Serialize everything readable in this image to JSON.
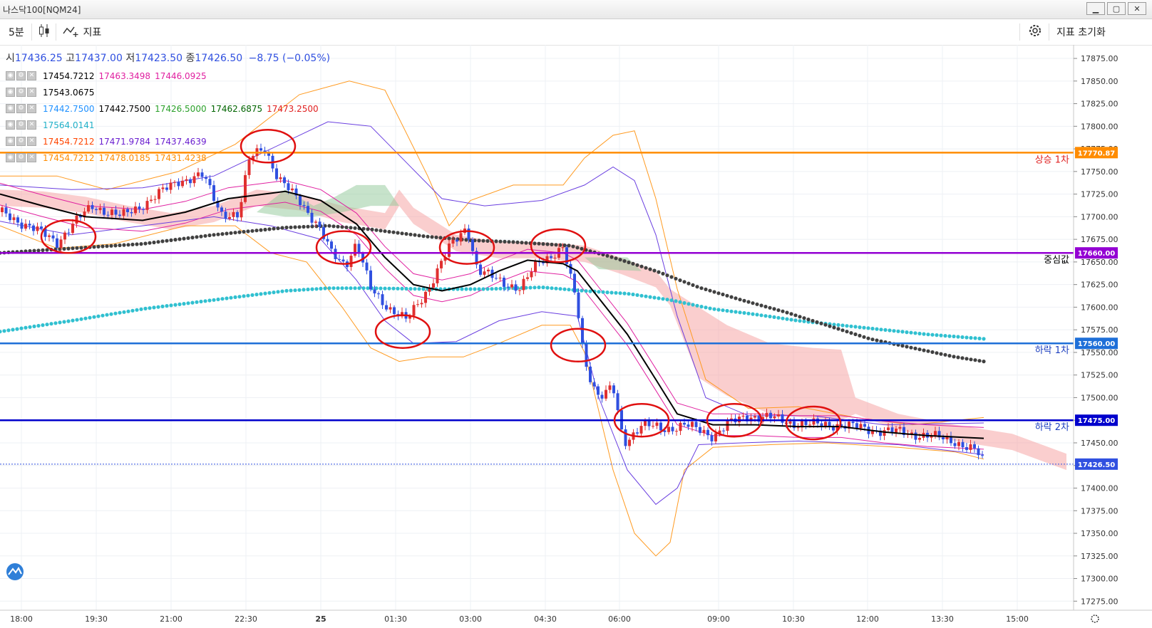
{
  "window": {
    "title": "나스닥100[NQM24]",
    "buttons": [
      "▁",
      "▢",
      "✕"
    ]
  },
  "toolbar": {
    "interval": "5분",
    "indicator_label": "지표",
    "reset_label": "지표 초기화"
  },
  "ohlc": {
    "open_label": "시",
    "open": "17436.25",
    "high_label": "고",
    "high": "17437.00",
    "low_label": "저",
    "low": "17423.50",
    "close_label": "종",
    "close": "17426.50",
    "change": "−8.75 (−0.05%)"
  },
  "indicators": [
    {
      "values": [
        {
          "v": "17454.7212",
          "c": "#000000"
        },
        {
          "v": "17463.3498",
          "c": "#e020a0"
        },
        {
          "v": "17446.0925",
          "c": "#e020a0"
        }
      ]
    },
    {
      "values": [
        {
          "v": "17543.0675",
          "c": "#000000"
        }
      ]
    },
    {
      "values": [
        {
          "v": "17442.7500",
          "c": "#1e90ff"
        },
        {
          "v": "17442.7500",
          "c": "#000000"
        },
        {
          "v": "17426.5000",
          "c": "#2aa02a"
        },
        {
          "v": "17462.6875",
          "c": "#006400"
        },
        {
          "v": "17473.2500",
          "c": "#e02020"
        }
      ]
    },
    {
      "values": [
        {
          "v": "17564.0141",
          "c": "#20b0c8"
        }
      ]
    },
    {
      "values": [
        {
          "v": "17454.7212",
          "c": "#ff4500"
        },
        {
          "v": "17471.9784",
          "c": "#6a1fd0"
        },
        {
          "v": "17437.4639",
          "c": "#6a1fd0"
        }
      ]
    },
    {
      "values": [
        {
          "v": "17454.7212",
          "c": "#ff8c00"
        },
        {
          "v": "17478.0185",
          "c": "#ff8c00"
        },
        {
          "v": "17431.4238",
          "c": "#ff8c00"
        }
      ]
    }
  ],
  "colors": {
    "up": "#e03030",
    "down": "#3050e0",
    "grid": "#eef0f4",
    "ma": "#000000",
    "dots_dark": "#404040",
    "dots_cyan": "#30c0d0"
  },
  "chart_data": {
    "type": "candlestick",
    "y_axis_ticks": [
      17875,
      17850,
      17825,
      17800,
      17775,
      17750,
      17725,
      17700,
      17675,
      17650,
      17625,
      17600,
      17575,
      17550,
      17525,
      17500,
      17475,
      17450,
      17425,
      17400,
      17375,
      17350,
      17325,
      17300,
      17275
    ],
    "y_tick_labels": [
      "17875.00",
      "17850.00",
      "17825.00",
      "17800.00",
      "17775.00",
      "17750.00",
      "17725.00",
      "17700.00",
      "17675.00",
      "17650.00",
      "17625.00",
      "17600.00",
      "17575.00",
      "17550.00",
      "17525.00",
      "17500.00",
      "17475.00",
      "17450.00",
      "17425.00",
      "17400.00",
      "17375.00",
      "17350.00",
      "17325.00",
      "17300.00",
      "17275.00"
    ],
    "ylim": [
      17265,
      17890
    ],
    "x_tick_labels": [
      "18:00",
      "19:30",
      "21:00",
      "22:30",
      "25",
      "01:30",
      "03:00",
      "04:30",
      "06:00",
      "09:00",
      "10:30",
      "12:00",
      "13:30",
      "15:00"
    ],
    "last_price": 17426.5,
    "last_price_label": "17426.50",
    "horizontal_levels": [
      {
        "value": 17770.87,
        "value_label": "17770.87",
        "label": "상승 1차",
        "color": "#ff8c00"
      },
      {
        "value": 17660.0,
        "value_label": "17660.00",
        "label": "중심값",
        "color": "#9400d3"
      },
      {
        "value": 17560.0,
        "value_label": "17560.00",
        "label": "하락 1차",
        "color": "#1e6fd8"
      },
      {
        "value": 17475.0,
        "value_label": "17475.00",
        "label": "하락 2차",
        "color": "#0000cc"
      }
    ],
    "price_path": [
      [
        0,
        17705
      ],
      [
        40,
        17690
      ],
      [
        80,
        17672
      ],
      [
        100,
        17690
      ],
      [
        130,
        17712
      ],
      [
        170,
        17700
      ],
      [
        210,
        17718
      ],
      [
        250,
        17740
      ],
      [
        285,
        17745
      ],
      [
        310,
        17705
      ],
      [
        335,
        17700
      ],
      [
        350,
        17765
      ],
      [
        370,
        17780
      ],
      [
        390,
        17740
      ],
      [
        420,
        17720
      ],
      [
        445,
        17690
      ],
      [
        465,
        17660
      ],
      [
        485,
        17648
      ],
      [
        500,
        17670
      ],
      [
        520,
        17620
      ],
      [
        545,
        17600
      ],
      [
        570,
        17585
      ],
      [
        600,
        17620
      ],
      [
        630,
        17665
      ],
      [
        655,
        17690
      ],
      [
        670,
        17640
      ],
      [
        700,
        17630
      ],
      [
        730,
        17620
      ],
      [
        755,
        17650
      ],
      [
        790,
        17665
      ],
      [
        810,
        17600
      ],
      [
        820,
        17540
      ],
      [
        840,
        17500
      ],
      [
        860,
        17510
      ],
      [
        875,
        17450
      ],
      [
        900,
        17470
      ],
      [
        930,
        17465
      ],
      [
        960,
        17470
      ],
      [
        1000,
        17458
      ],
      [
        1020,
        17470
      ],
      [
        1050,
        17480
      ],
      [
        1080,
        17478
      ],
      [
        1110,
        17472
      ],
      [
        1140,
        17470
      ],
      [
        1180,
        17470
      ],
      [
        1220,
        17465
      ],
      [
        1260,
        17462
      ],
      [
        1300,
        17458
      ],
      [
        1340,
        17452
      ],
      [
        1370,
        17440
      ],
      [
        1382,
        17426
      ]
    ],
    "moving_average": [
      [
        0,
        17725
      ],
      [
        60,
        17712
      ],
      [
        120,
        17700
      ],
      [
        200,
        17696
      ],
      [
        260,
        17705
      ],
      [
        320,
        17720
      ],
      [
        400,
        17728
      ],
      [
        450,
        17718
      ],
      [
        500,
        17692
      ],
      [
        540,
        17655
      ],
      [
        580,
        17625
      ],
      [
        620,
        17618
      ],
      [
        660,
        17625
      ],
      [
        700,
        17640
      ],
      [
        740,
        17652
      ],
      [
        790,
        17648
      ],
      [
        810,
        17640
      ],
      [
        840,
        17610
      ],
      [
        880,
        17570
      ],
      [
        920,
        17520
      ],
      [
        950,
        17482
      ],
      [
        1000,
        17470
      ],
      [
        1060,
        17470
      ],
      [
        1120,
        17468
      ],
      [
        1180,
        17468
      ],
      [
        1240,
        17462
      ],
      [
        1300,
        17458
      ],
      [
        1380,
        17455
      ]
    ],
    "bollinger_orange": {
      "upper": [
        [
          0,
          17745
        ],
        [
          80,
          17745
        ],
        [
          150,
          17730
        ],
        [
          250,
          17750
        ],
        [
          330,
          17780
        ],
        [
          420,
          17835
        ],
        [
          490,
          17850
        ],
        [
          540,
          17840
        ],
        [
          600,
          17745
        ],
        [
          630,
          17690
        ],
        [
          660,
          17718
        ],
        [
          720,
          17735
        ],
        [
          790,
          17735
        ],
        [
          820,
          17765
        ],
        [
          860,
          17790
        ],
        [
          890,
          17795
        ],
        [
          920,
          17720
        ],
        [
          950,
          17620
        ],
        [
          990,
          17520
        ],
        [
          1050,
          17488
        ],
        [
          1120,
          17490
        ],
        [
          1200,
          17478
        ],
        [
          1280,
          17470
        ],
        [
          1380,
          17478
        ]
      ],
      "lower": [
        [
          0,
          17690
        ],
        [
          80,
          17665
        ],
        [
          160,
          17670
        ],
        [
          260,
          17690
        ],
        [
          330,
          17690
        ],
        [
          380,
          17660
        ],
        [
          430,
          17650
        ],
        [
          480,
          17600
        ],
        [
          520,
          17555
        ],
        [
          560,
          17540
        ],
        [
          600,
          17545
        ],
        [
          650,
          17545
        ],
        [
          700,
          17560
        ],
        [
          760,
          17580
        ],
        [
          800,
          17580
        ],
        [
          820,
          17550
        ],
        [
          860,
          17420
        ],
        [
          890,
          17350
        ],
        [
          920,
          17325
        ],
        [
          940,
          17340
        ],
        [
          960,
          17420
        ],
        [
          1000,
          17445
        ],
        [
          1080,
          17448
        ],
        [
          1160,
          17450
        ],
        [
          1260,
          17445
        ],
        [
          1340,
          17440
        ],
        [
          1380,
          17432
        ]
      ]
    },
    "bollinger_purple": {
      "upper": [
        [
          0,
          17735
        ],
        [
          100,
          17730
        ],
        [
          200,
          17732
        ],
        [
          300,
          17745
        ],
        [
          380,
          17775
        ],
        [
          460,
          17805
        ],
        [
          520,
          17800
        ],
        [
          570,
          17760
        ],
        [
          620,
          17720
        ],
        [
          680,
          17712
        ],
        [
          760,
          17718
        ],
        [
          820,
          17735
        ],
        [
          860,
          17755
        ],
        [
          890,
          17740
        ],
        [
          920,
          17680
        ],
        [
          950,
          17590
        ],
        [
          990,
          17500
        ],
        [
          1050,
          17480
        ],
        [
          1140,
          17480
        ],
        [
          1240,
          17470
        ],
        [
          1380,
          17472
        ]
      ],
      "lower": [
        [
          0,
          17695
        ],
        [
          100,
          17680
        ],
        [
          200,
          17690
        ],
        [
          300,
          17700
        ],
        [
          380,
          17690
        ],
        [
          450,
          17675
        ],
        [
          500,
          17630
        ],
        [
          540,
          17585
        ],
        [
          580,
          17560
        ],
        [
          640,
          17562
        ],
        [
          700,
          17585
        ],
        [
          760,
          17595
        ],
        [
          810,
          17590
        ],
        [
          840,
          17500
        ],
        [
          880,
          17420
        ],
        [
          920,
          17382
        ],
        [
          950,
          17400
        ],
        [
          980,
          17448
        ],
        [
          1040,
          17450
        ],
        [
          1120,
          17452
        ],
        [
          1260,
          17448
        ],
        [
          1380,
          17437
        ]
      ]
    },
    "ichimoku_cloud": [
      [
        0,
        17730
      ],
      [
        60,
        17728
      ],
      [
        120,
        17722
      ],
      [
        180,
        17712
      ],
      [
        240,
        17704
      ],
      [
        300,
        17712
      ],
      [
        360,
        17730
      ],
      [
        420,
        17725
      ],
      [
        480,
        17712
      ],
      [
        540,
        17704
      ],
      [
        560,
        17730
      ],
      [
        580,
        17710
      ],
      [
        600,
        17700
      ],
      [
        640,
        17680
      ],
      [
        700,
        17672
      ],
      [
        760,
        17672
      ],
      [
        820,
        17668
      ],
      [
        870,
        17655
      ],
      [
        920,
        17640
      ],
      [
        940,
        17620
      ],
      [
        980,
        17600
      ],
      [
        1020,
        17580
      ],
      [
        1080,
        17560
      ],
      [
        1140,
        17555
      ],
      [
        1180,
        17553
      ],
      [
        1200,
        17500
      ],
      [
        1260,
        17482
      ],
      [
        1340,
        17470
      ],
      [
        1420,
        17460
      ],
      [
        1496,
        17438
      ]
    ],
    "dots_dark_path": [
      [
        0,
        17660
      ],
      [
        100,
        17665
      ],
      [
        200,
        17670
      ],
      [
        300,
        17680
      ],
      [
        400,
        17688
      ],
      [
        460,
        17690
      ],
      [
        520,
        17686
      ],
      [
        600,
        17678
      ],
      [
        660,
        17674
      ],
      [
        720,
        17672
      ],
      [
        800,
        17668
      ],
      [
        860,
        17655
      ],
      [
        920,
        17640
      ],
      [
        980,
        17622
      ],
      [
        1040,
        17608
      ],
      [
        1100,
        17595
      ],
      [
        1160,
        17580
      ],
      [
        1220,
        17565
      ],
      [
        1280,
        17555
      ],
      [
        1340,
        17545
      ],
      [
        1380,
        17540
      ]
    ],
    "dots_cyan_path": [
      [
        0,
        17573
      ],
      [
        100,
        17585
      ],
      [
        200,
        17598
      ],
      [
        300,
        17608
      ],
      [
        400,
        17618
      ],
      [
        460,
        17621
      ],
      [
        520,
        17621
      ],
      [
        600,
        17620
      ],
      [
        680,
        17620
      ],
      [
        760,
        17622
      ],
      [
        820,
        17618
      ],
      [
        880,
        17615
      ],
      [
        940,
        17608
      ],
      [
        1000,
        17598
      ],
      [
        1060,
        17592
      ],
      [
        1120,
        17585
      ],
      [
        1180,
        17580
      ],
      [
        1240,
        17575
      ],
      [
        1300,
        17570
      ],
      [
        1380,
        17565
      ]
    ],
    "annotation_ellipses": [
      [
        96,
        17678
      ],
      [
        376,
        17778
      ],
      [
        482,
        17666
      ],
      [
        565,
        17573
      ],
      [
        655,
        17666
      ],
      [
        783,
        17668
      ],
      [
        811,
        17558
      ],
      [
        900,
        17475
      ],
      [
        1030,
        17475
      ],
      [
        1141,
        17472
      ]
    ]
  }
}
